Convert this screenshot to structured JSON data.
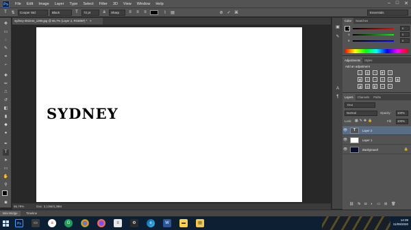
{
  "app": {
    "logo": "Ps"
  },
  "menu": [
    "File",
    "Edit",
    "Image",
    "Layer",
    "Type",
    "Select",
    "Filter",
    "3D",
    "View",
    "Window",
    "Help"
  ],
  "window_controls": [
    "–",
    "□",
    "✕"
  ],
  "options_bar": {
    "font_family": "Cooper Std",
    "font_style": "Black",
    "font_size": "72 pt",
    "antialias": "Sharp",
    "workspace": "Essentials"
  },
  "document": {
    "tab_title": "sydney-363244_1280.jpg @ 66,7% (Layer 2, RGB/8#) *",
    "close_glyph": "×",
    "canvas_text": "SYDNEY"
  },
  "status": {
    "zoom": "66,79%",
    "doc_size": "Doc: 3,13M/3,38M"
  },
  "bottom_panel": {
    "tabs": [
      "Mini Bridge",
      "Timeline"
    ]
  },
  "color_panel": {
    "tabs": [
      "Color",
      "Swatches"
    ],
    "channels": [
      {
        "label": "R",
        "value": "0"
      },
      {
        "label": "G",
        "value": "0"
      },
      {
        "label": "B",
        "value": "0"
      }
    ]
  },
  "adjustments_panel": {
    "tabs": [
      "Adjustments",
      "Styles"
    ],
    "title": "Add an adjustment"
  },
  "layers_panel": {
    "tabs": [
      "Layers",
      "Channels",
      "Paths"
    ],
    "filter_label": "Kind",
    "blend_mode": "Normal",
    "opacity_label": "Opacity:",
    "opacity_value": "100%",
    "lock_label": "Lock:",
    "fill_label": "Fill:",
    "fill_value": "100%",
    "layers": [
      {
        "name": "Layer 2",
        "thumb": "T",
        "active": true
      },
      {
        "name": "Layer 1",
        "thumb": "",
        "active": false
      },
      {
        "name": "Background",
        "thumb": "",
        "active": false
      }
    ]
  },
  "taskbar": {
    "time": "14:39",
    "date": "11/09/2020"
  },
  "colors": {
    "accent": "#0078d7",
    "ps_blue": "#31a8ff",
    "selected_layer": "#5a6d86"
  }
}
